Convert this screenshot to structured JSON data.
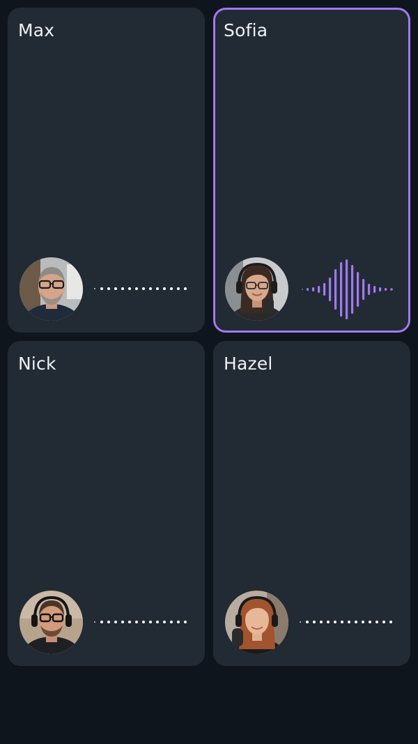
{
  "participants": [
    {
      "name": "Max",
      "speaking": false,
      "avatar": "man-glasses-beard-avatar"
    },
    {
      "name": "Sofia",
      "speaking": true,
      "avatar": "woman-glasses-headphones-avatar"
    },
    {
      "name": "Nick",
      "speaking": false,
      "avatar": "man-glasses-headphones-avatar"
    },
    {
      "name": "Hazel",
      "speaking": false,
      "avatar": "woman-headphones-avatar"
    }
  ],
  "colors": {
    "background": "#0e151c",
    "tile": "#222a34",
    "speaking_accent": "#a17af0",
    "text": "#eef2f5"
  }
}
